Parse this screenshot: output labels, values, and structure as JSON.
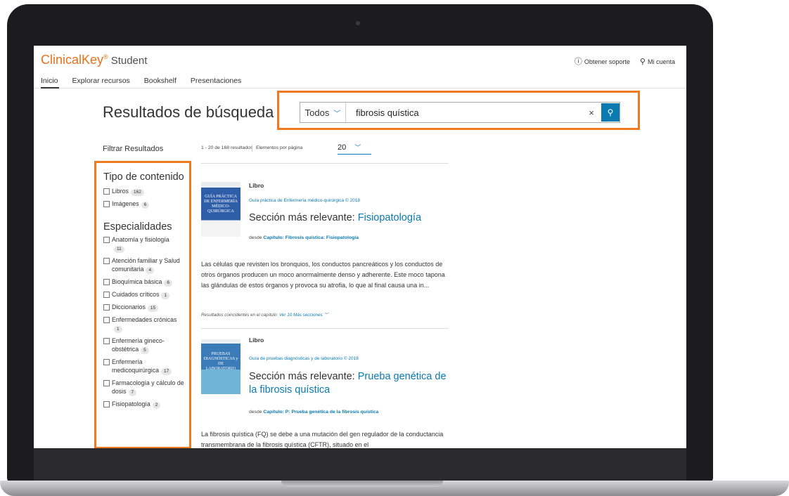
{
  "app": {
    "brand": "ClinicalKey",
    "brand_sup": "®",
    "product": "Student"
  },
  "header_links": [
    {
      "label": "Obtener soporte",
      "icon": "help-circle-icon"
    },
    {
      "label": "Mi cuenta",
      "icon": "user-icon"
    }
  ],
  "nav": [
    "Inicio",
    "Explorar recursos",
    "Bookshelf",
    "Presentaciones"
  ],
  "page_title": "Resultados de búsqueda",
  "search": {
    "scope": "Todos",
    "query": "fibrosis quística",
    "clear": "×",
    "button_icon": "search-icon"
  },
  "filters": {
    "title": "Filtrar Resultados",
    "content_type": {
      "heading": "Tipo de contenido",
      "items": [
        {
          "label": "Libros",
          "count": "162"
        },
        {
          "label": "Imágenes",
          "count": "6"
        }
      ]
    },
    "specialties": {
      "heading": "Especialidades",
      "items": [
        {
          "label": "Anatomía y fisiología",
          "count": "11"
        },
        {
          "label": "Atención familiar y Salud comunitaria",
          "count": "4"
        },
        {
          "label": "Bioquímica básica",
          "count": "6"
        },
        {
          "label": "Cuidados críticos",
          "count": "1"
        },
        {
          "label": "Diccionarios",
          "count": "15"
        },
        {
          "label": "Enfermedades crónicas",
          "count": "1"
        },
        {
          "label": "Enfermería gineco-obstétrica",
          "count": "5"
        },
        {
          "label": "Enfermería medicoquirúrgica",
          "count": "17"
        },
        {
          "label": "Farmacología y cálculo de dosis",
          "count": "7"
        },
        {
          "label": "Fisiopatología",
          "count": "2"
        }
      ]
    }
  },
  "results_meta": {
    "range": "1 - 20 de 168 resultados",
    "per_page_label": "Elementos por página",
    "per_page_value": "20"
  },
  "results": [
    {
      "type": "Libro",
      "cover_text": "GUÍA PRÁCTICA DE ENFERMERÍA MÉDICO-QUIRÚRGICA",
      "source": "Guía práctica de Enfermería médico-quirúrgica © 2018",
      "title_prefix": "Sección más relevante:",
      "title_link": "Fisiopatología",
      "from_label": "desde",
      "from_link": "Capítulo: Fibrosis quística: Fisiopatología",
      "description": "Las células que revisten los bronquios, los conductos pancreáticos y los conductos de otros órganos producen un moco anormalmente denso y adherente. Este moco tapona las glándulas de estos órganos y provoca su atrofia, lo que al final causa una in...",
      "more_label": "Resultados coincidentes en el capítulo:",
      "more_link": "Ver 10 Más secciones"
    },
    {
      "type": "Libro",
      "cover_text": "PRUEBAS DIAGNÓSTICAS y DE LABORATORIO",
      "source": "Guía de pruebas diagnósticas y de laboratorio © 2018",
      "title_prefix": "Sección más relevante:",
      "title_link": "Prueba genética de la fibrosis quística",
      "from_label": "desde",
      "from_link": "Capítulo: P: Prueba genética de la fibrosis quística",
      "description": "La fibrosis quística (FQ) se debe a una mutación del gen regulador de la conductancia transmembrana de la fibrosis quística (CFTR), situado en el"
    }
  ],
  "colors": {
    "accent": "#0a7ab1",
    "brand": "#e9711c",
    "highlight": "#f07a1f"
  }
}
